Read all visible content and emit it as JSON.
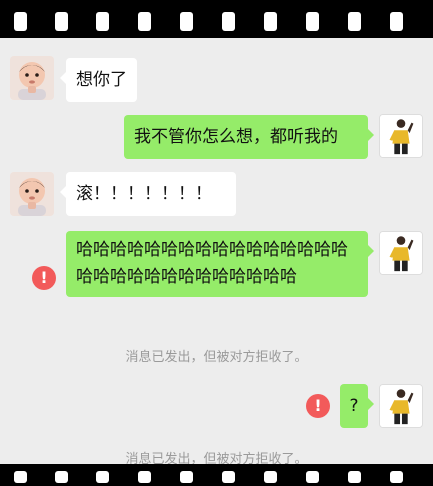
{
  "colors": {
    "sent_bubble": "#95ec69",
    "received_bubble": "#ffffff",
    "chat_bg": "#ededed",
    "error": "#f25a5a",
    "film": "#000000"
  },
  "messages": [
    {
      "side": "left",
      "text": "想你了"
    },
    {
      "side": "right",
      "text": "我不管你怎么想，都听我的"
    },
    {
      "side": "left",
      "text": "滚！！！！！！！"
    },
    {
      "side": "right",
      "text": "哈哈哈哈哈哈哈哈哈哈哈哈哈哈哈哈哈哈哈哈哈哈哈哈哈哈哈哈哈",
      "failed": true
    },
    {
      "side": "right",
      "text": "?",
      "failed": true
    }
  ],
  "error_icon_text": "!",
  "system_notices": [
    "消息已发出，但被对方拒收了。",
    "消息已发出，但被对方拒收了。"
  ],
  "icons": {
    "contact_avatar": "baby-avatar-icon",
    "self_avatar": "man-avatar-icon",
    "failed": "error-icon"
  }
}
